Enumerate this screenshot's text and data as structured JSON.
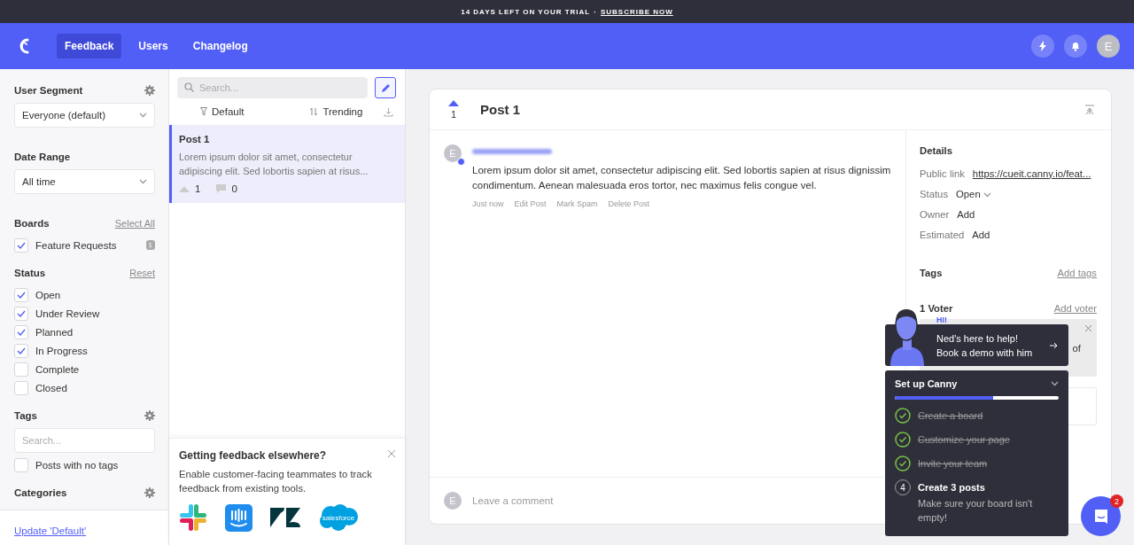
{
  "banner": {
    "text": "14 DAYS LEFT ON YOUR TRIAL",
    "separator": "·",
    "link": "SUBSCRIBE NOW"
  },
  "nav": {
    "tabs": [
      {
        "label": "Feedback",
        "selected": true
      },
      {
        "label": "Users",
        "selected": false
      },
      {
        "label": "Changelog",
        "selected": false
      }
    ],
    "avatar": "E"
  },
  "filters": {
    "user_segment": {
      "title": "User Segment",
      "value": "Everyone (default)"
    },
    "date_range": {
      "title": "Date Range",
      "value": "All time"
    },
    "boards": {
      "title": "Boards",
      "action": "Select All",
      "items": [
        {
          "label": "Feature Requests",
          "checked": true,
          "count": "1"
        }
      ]
    },
    "status": {
      "title": "Status",
      "action": "Reset",
      "items": [
        {
          "label": "Open",
          "checked": true
        },
        {
          "label": "Under Review",
          "checked": true
        },
        {
          "label": "Planned",
          "checked": true
        },
        {
          "label": "In Progress",
          "checked": true
        },
        {
          "label": "Complete",
          "checked": false
        },
        {
          "label": "Closed",
          "checked": false
        }
      ]
    },
    "tags": {
      "title": "Tags",
      "placeholder": "Search...",
      "items": [
        {
          "label": "Posts with no tags",
          "checked": false
        }
      ]
    },
    "categories": {
      "title": "Categories"
    },
    "footer_link": "Update 'Default'"
  },
  "post_list": {
    "search_placeholder": "Search...",
    "filter": "Default",
    "sort": "Trending",
    "posts": [
      {
        "title": "Post 1",
        "excerpt": "Lorem ipsum dolor sit amet, consectetur adipiscing elit. Sed lobortis sapien at risus...",
        "votes": "1",
        "comments": "0",
        "selected": true
      }
    ],
    "promo": {
      "title": "Getting feedback elsewhere?",
      "text": "Enable customer-facing teammates to track feedback from existing tools.",
      "integrations": [
        {
          "kind": "slack"
        },
        {
          "kind": "intercom"
        },
        {
          "kind": "zendesk"
        },
        {
          "kind": "salesforce",
          "label": "salesforce"
        }
      ]
    }
  },
  "post": {
    "votes": "1",
    "title": "Post 1",
    "author_avatar": "E",
    "body": "Lorem ipsum dolor sit amet, consectetur adipiscing elit. Sed lobortis sapien at risus dignissim condimentum. Aenean malesuada eros tortor, nec maximus felis congue vel.",
    "actions": [
      "Just now",
      "Edit Post",
      "Mark Spam",
      "Delete Post"
    ],
    "comment_avatar": "E",
    "comment_placeholder": "Leave a comment"
  },
  "details": {
    "title": "Details",
    "rows": [
      {
        "label": "Public link",
        "value": "https://cueit.canny.io/feat...",
        "kind": "link"
      },
      {
        "label": "Status",
        "value": "Open",
        "kind": "dropdown"
      },
      {
        "label": "Owner",
        "value": "Add",
        "kind": "text"
      },
      {
        "label": "Estimated",
        "value": "Add",
        "kind": "text"
      }
    ],
    "tags_title": "Tags",
    "tags_action": "Add tags",
    "voters_title": "1 Voter",
    "voters_action": "Add voter",
    "notice_text": "of"
  },
  "ned": {
    "greeting": "HI!",
    "line1": "Ned's here to help!",
    "line2": "Book a demo with him"
  },
  "setup": {
    "title": "Set up Canny",
    "level": 0.6,
    "steps": [
      {
        "label": "Create a board",
        "done": true
      },
      {
        "label": "Customize your page",
        "done": true
      },
      {
        "label": "Invite your team",
        "done": true
      },
      {
        "number": "4",
        "label": "Create 3 posts",
        "done": false,
        "description": "Make sure your board isn't empty!"
      }
    ]
  },
  "chat": {
    "badge": "2"
  }
}
